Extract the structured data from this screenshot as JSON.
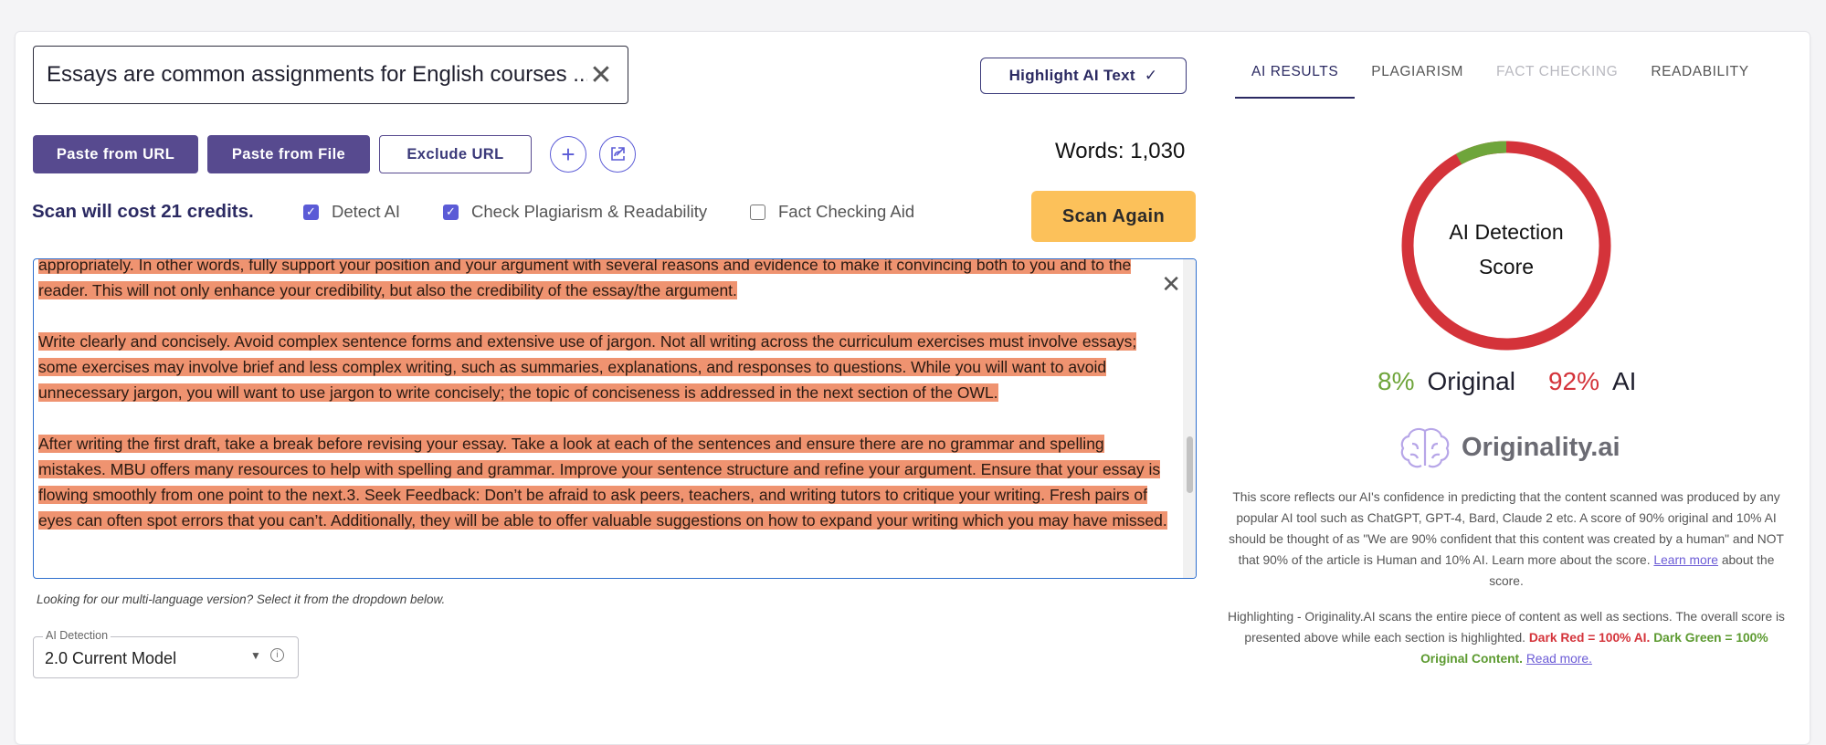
{
  "title_input": {
    "value": "Essays are common assignments for English courses ..."
  },
  "highlight_button": {
    "label": "Highlight AI Text",
    "check": "✓"
  },
  "buttons": {
    "paste_url": "Paste from URL",
    "paste_file": "Paste from File",
    "exclude_url": "Exclude URL",
    "add_icon": "+",
    "scan_again": "Scan Again"
  },
  "words": "Words: 1,030",
  "cost": "Scan will cost 21 credits.",
  "options": {
    "detect_ai": {
      "label": "Detect AI",
      "checked": true
    },
    "plagiarism": {
      "label": "Check Plagiarism & Readability",
      "checked": true
    },
    "fact_check": {
      "label": "Fact Checking Aid",
      "checked": false
    }
  },
  "editor": {
    "paragraphs": [
      "appropriately. In other words, fully support your position and your argument with several reasons and evidence to make it convincing both to you and to the reader. This will not only enhance your credibility, but also the credibility of the essay/the argument.",
      "Write clearly and concisely. Avoid complex sentence forms and extensive use of jargon. Not all writing across the curriculum exercises must involve essays; some exercises may involve brief and less complex writing, such as summaries, explanations, and responses to questions. While you will want to avoid unnecessary jargon, you will want to use jargon to write concisely; the topic of conciseness is addressed in the next section of the OWL.",
      "After writing the first draft, take a break before revising your essay. Take a look at each of the sentences and ensure there are no grammar and spelling mistakes. MBU offers many resources to help with spelling and grammar. Improve your sentence structure and refine your argument. Ensure that your essay is flowing smoothly from one point to the next.3. Seek Feedback: Don’t be afraid to ask peers, teachers, and writing tutors to critique your writing. Fresh pairs of eyes can often spot errors that you can’t. Additionally, they will be able to offer valuable suggestions on how to expand your writing which you may have missed."
    ],
    "highlight_color": "#ef9370"
  },
  "hint": "Looking for our multi-language version? Select it from the dropdown below.",
  "model_select": {
    "label": "AI Detection",
    "value": "2.0 Current Model"
  },
  "tabs": [
    {
      "label": "AI RESULTS",
      "state": "active"
    },
    {
      "label": "PLAGIARISM",
      "state": "normal"
    },
    {
      "label": "FACT CHECKING",
      "state": "disabled"
    },
    {
      "label": "READABILITY",
      "state": "normal"
    }
  ],
  "score": {
    "label_line1": "AI Detection",
    "label_line2": "Score",
    "original_pct": "8%",
    "original_label": "Original",
    "ai_pct": "92%",
    "ai_label": "AI",
    "original_fraction": 0.08,
    "ai_fraction": 0.92,
    "colors": {
      "original": "#6fa53b",
      "ai": "#d4333a"
    }
  },
  "brand": {
    "name": "Originality.ai"
  },
  "description": {
    "text": "This score reflects our AI's confidence in predicting that the content scanned was produced by any popular AI tool such as ChatGPT, GPT-4, Bard, Claude 2 etc. A score of 90% original and 10% AI should be thought of as \"We are 90% confident that this content was created by a human\" and NOT that 90% of the article is Human and 10% AI. Learn more about the score.",
    "link": "Learn more",
    "after_link": "about the score."
  },
  "highlighting": {
    "text": "Highlighting - Originality.AI scans the entire piece of content as well as sections. The overall score is presented above while each section is highlighted.",
    "red": "Dark Red = 100% AI.",
    "green": "Dark Green = 100% Original Content.",
    "link": "Read more."
  }
}
